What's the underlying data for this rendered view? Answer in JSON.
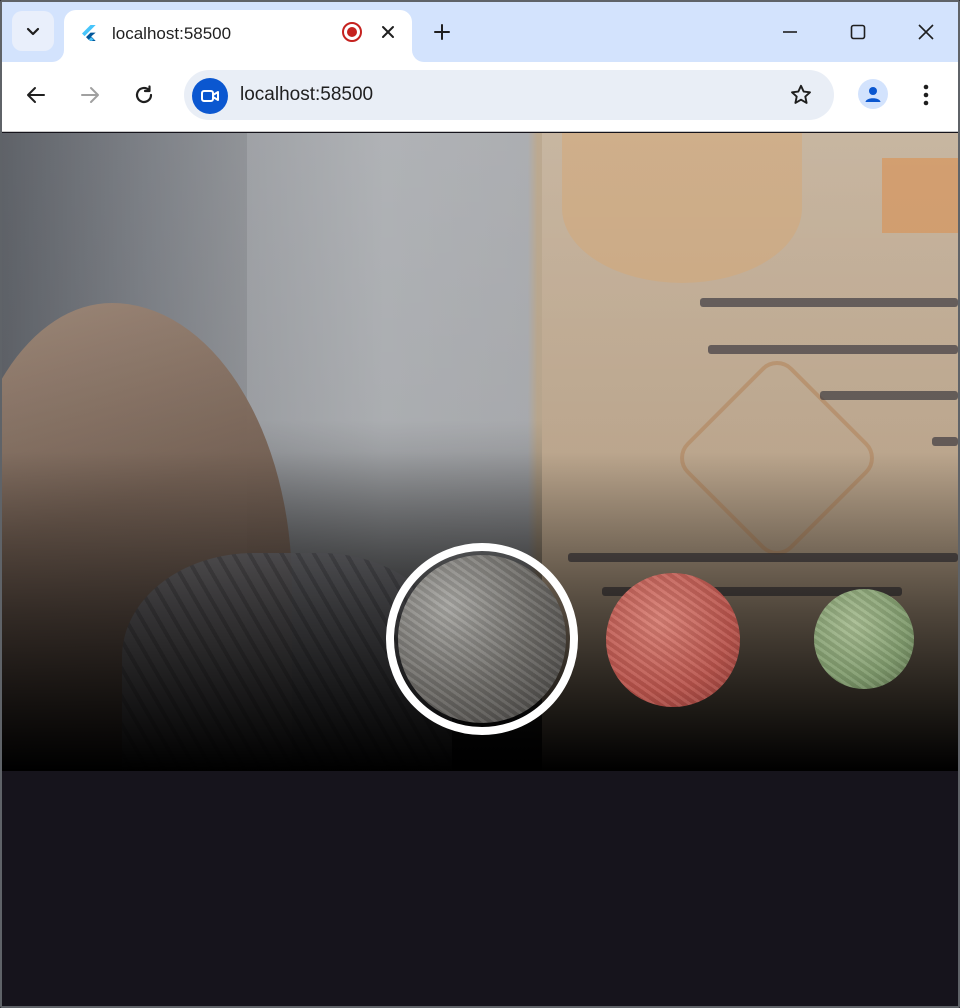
{
  "browser": {
    "tab": {
      "title": "localhost:58500",
      "recording": true
    },
    "address_bar": {
      "url": "localhost:58500"
    },
    "colors": {
      "tabstrip": "#d3e3fd",
      "accent": "#0b57d0",
      "record": "#c5221f"
    }
  },
  "camera_app": {
    "filters": [
      {
        "name": "normal",
        "selected": true,
        "color": "#6e6c68"
      },
      {
        "name": "red",
        "selected": false,
        "color": "#b8534b"
      },
      {
        "name": "green",
        "selected": false,
        "color": "#7f9a6c"
      }
    ],
    "colors": {
      "background": "#16141c",
      "selected_ring": "#ffffff"
    }
  }
}
